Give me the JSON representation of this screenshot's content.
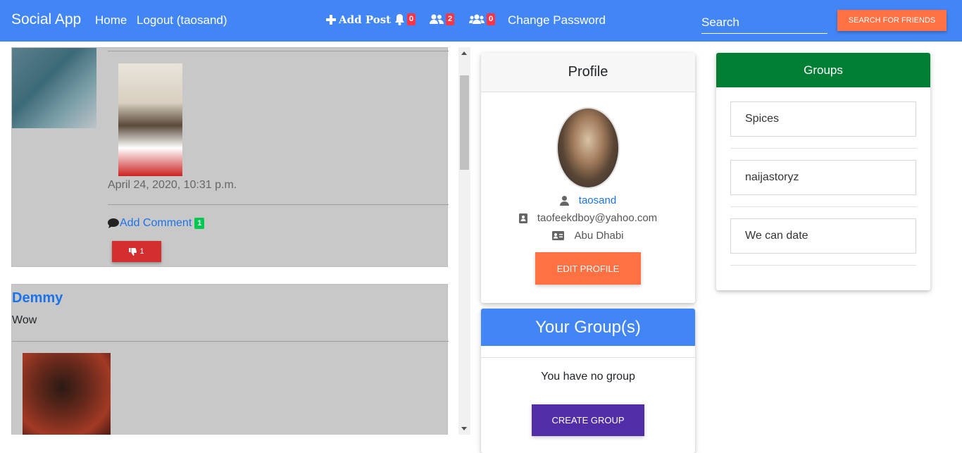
{
  "navbar": {
    "brand": "Social App",
    "home": "Home",
    "logout": "Logout (taosand)",
    "add_post": "Add Post",
    "notifications_count": "0",
    "friend_requests_count": "2",
    "groups_count": "0",
    "change_password": "Change Password",
    "search_placeholder": "Search",
    "search_button": "SEARCH FOR FRIENDS"
  },
  "feed": {
    "post1": {
      "date": "April 24, 2020, 10:31 p.m.",
      "add_comment": "Add Comment",
      "comment_count": "1",
      "dislike_count": "1"
    },
    "post2": {
      "author": "Demmy",
      "text": "Wow"
    }
  },
  "profile": {
    "title": "Profile",
    "username": "taosand",
    "email": "taofeekdboy@yahoo.com",
    "location": "Abu Dhabi",
    "edit_button": "EDIT PROFILE"
  },
  "your_groups": {
    "title": "Your Group(s)",
    "empty_text": "You have no group",
    "create_button": "CREATE GROUP"
  },
  "groups": {
    "title": "Groups",
    "items": [
      "Spices",
      "naijastoryz",
      "We can date"
    ]
  },
  "colors": {
    "primary": "#4285f4",
    "accent": "#ff7043",
    "success": "#007e33",
    "danger": "#d32f2f",
    "purple": "#512da8"
  }
}
